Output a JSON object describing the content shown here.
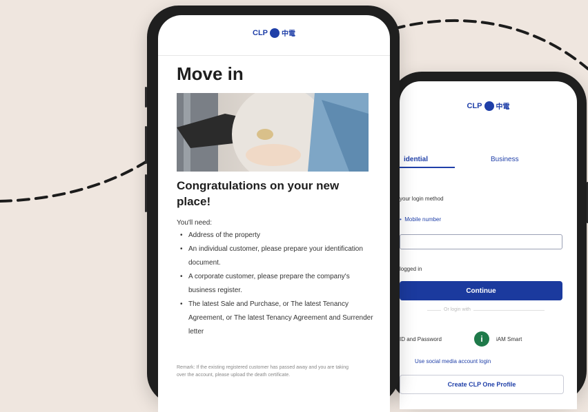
{
  "brand": {
    "name": "CLP",
    "chinese": "中電",
    "color": "#1f3fa8"
  },
  "move_in_screen": {
    "title": "Move in",
    "heading": "Congratulations on your new place!",
    "intro": "You'll need:",
    "requirements": [
      "Address of the property",
      "An individual customer, please prepare your identification document.",
      "A corporate customer, please prepare the company's business register.",
      "The latest Sale and Purchase, or The latest Tenancy Agreement, or The latest Tenancy Agreement and Surrender letter"
    ],
    "remark": "Remark: If the existing registered customer has passed away and you are taking over the account, please upload the death certificate."
  },
  "login_screen": {
    "tabs": [
      "Residential",
      "Business"
    ],
    "tab_visible_residential": "idential",
    "login_method_label": "your login method",
    "mobile_option": "Mobile number",
    "keep_logged_in": "logged in",
    "continue_label": "Continue",
    "or_login_with": "Or login with",
    "id_password": "ID and Password",
    "iam_smart": "iAM Smart",
    "social_link": "Use social media account login",
    "create_label": "Create CLP One Profile",
    "accent": "#1b3a9e"
  }
}
